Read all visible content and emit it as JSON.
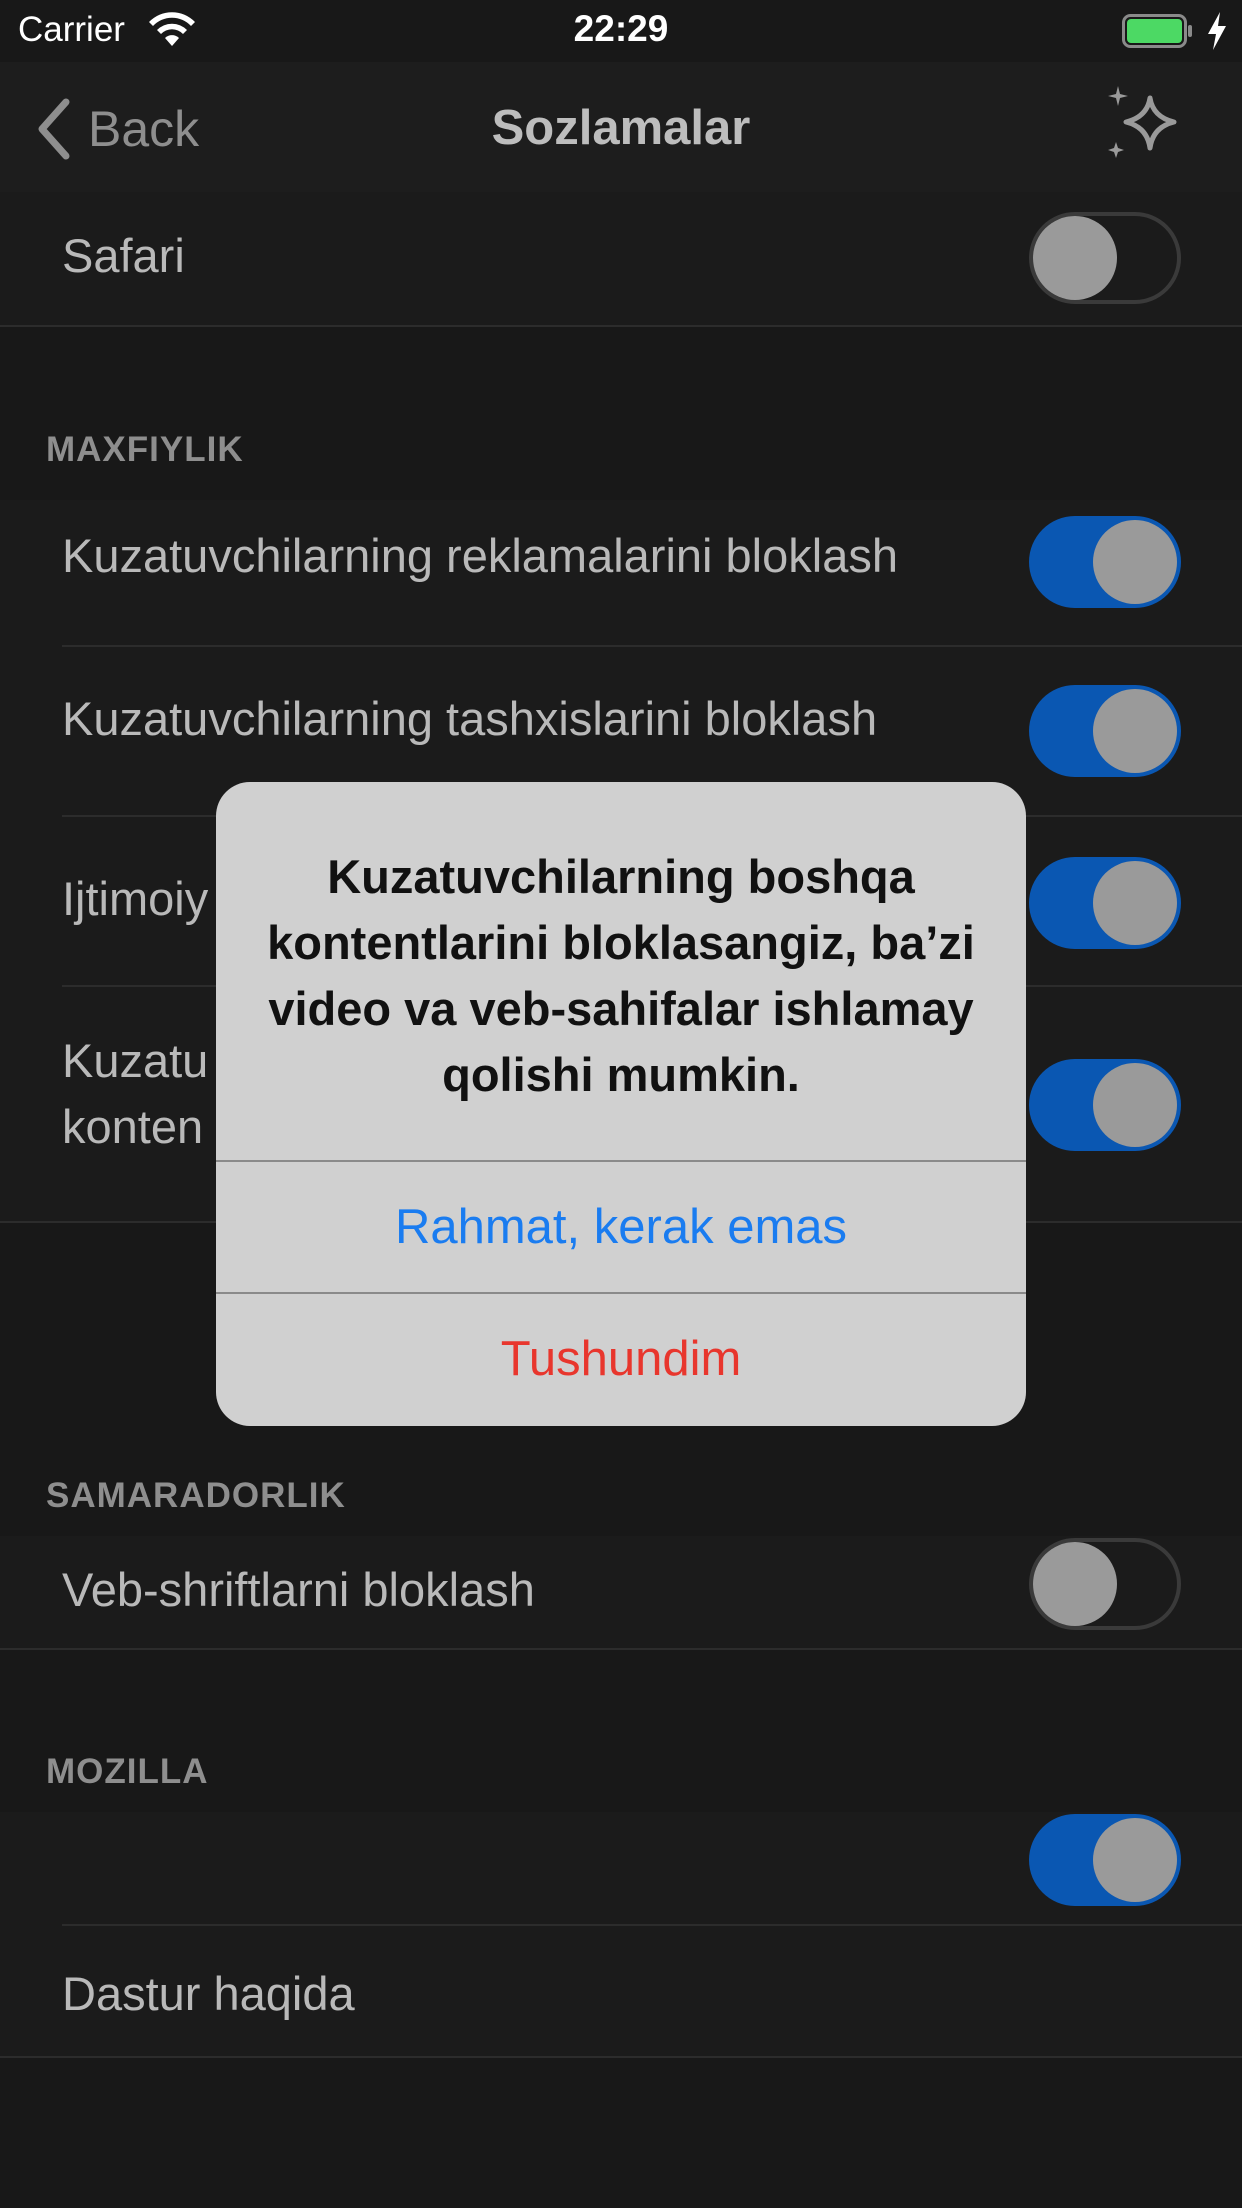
{
  "status_bar": {
    "carrier": "Carrier",
    "time": "22:29"
  },
  "nav": {
    "back_label": "Back",
    "title": "Sozlamalar"
  },
  "rows": {
    "safari": {
      "label": "Safari",
      "enabled": false
    },
    "privacy_header": "MAXFIYLIK",
    "block_ads": {
      "label": "Kuzatuvchilarning reklamalarini bloklash",
      "enabled": true
    },
    "block_analytics": {
      "label": "Kuzatuvchilarning tashxislarini bloklash",
      "enabled": true
    },
    "block_social": {
      "label_visible": "Ijtimoiy",
      "enabled": true
    },
    "block_other": {
      "label_visible_line1": "Kuzatu",
      "label_visible_line2": "konten",
      "enabled": true
    },
    "performance_header": "SAMARADORLIK",
    "block_fonts": {
      "label": "Veb-shriftlarni bloklash",
      "enabled": false
    },
    "mozilla_header": "MOZILLA",
    "mozilla_toggle": {
      "enabled": true
    },
    "about": {
      "label": "Dastur haqida"
    }
  },
  "alert": {
    "message": "Kuzatuvchilarning boshqa kontentlarini bloklasangiz, ba’zi video va veb-sahifalar ishlamay qolishi mumkin.",
    "cancel_label": "Rahmat, kerak emas",
    "confirm_label": "Tushundim",
    "colors": {
      "cancel": "#1a7cf0",
      "confirm": "#e8362d"
    }
  },
  "colors": {
    "toggle_on": "#0a57b2",
    "battery": "#4cd964"
  },
  "icons": {
    "back": "chevron-left-icon",
    "sparkle": "sparkle-icon",
    "wifi": "wifi-icon",
    "battery": "battery-icon",
    "bolt": "charging-bolt-icon"
  }
}
